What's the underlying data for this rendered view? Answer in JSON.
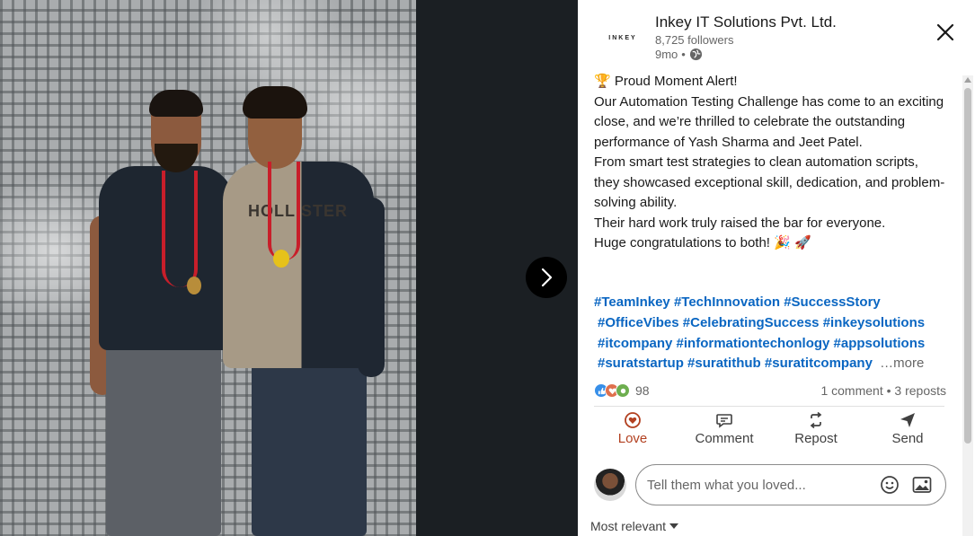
{
  "post": {
    "company_name": "Inkey IT Solutions Pvt. Ltd.",
    "logo_text": "INKEY",
    "followers": "8,725 followers",
    "time_ago": "9mo",
    "separator": "•",
    "visibility_icon": "globe-icon",
    "body_lines": [
      "🏆 Proud Moment Alert!",
      "Our Automation Testing Challenge has come to an exciting close, and we’re thrilled to celebrate the outstanding performance of Yash Sharma and Jeet Patel.",
      "From smart test strategies to clean automation scripts, they showcased exceptional skill, dedication, and problem-solving ability.",
      "Their hard work truly raised the bar for everyone.",
      "Huge congratulations to both! 🎉 🚀"
    ],
    "hashtags": [
      "#TeamInkey",
      "#TechInnovation",
      "#SuccessStory",
      "#OfficeVibes",
      "#CelebratingSuccess",
      "#inkeysolutions",
      "#itcompany",
      "#informationtechonlogy",
      "#appsolutions",
      "#suratstartup",
      "#suratithub",
      "#suratitcompany"
    ],
    "more_label": "…more"
  },
  "social": {
    "reaction_count": "98",
    "comments": "1 comment",
    "dot": "•",
    "reposts": "3 reposts",
    "reaction_icons": [
      "like-icon",
      "love-icon",
      "support-icon"
    ]
  },
  "actions": {
    "love": "Love",
    "comment": "Comment",
    "repost": "Repost",
    "send": "Send"
  },
  "comment_box": {
    "placeholder": "Tell them what you loved..."
  },
  "sort": {
    "label": "Most relevant"
  },
  "photo": {
    "shirt_text": "HOLLISTER"
  },
  "colors": {
    "link": "#0a66c2",
    "love": "#b24020",
    "text": "#191919",
    "muted": "#666666"
  }
}
